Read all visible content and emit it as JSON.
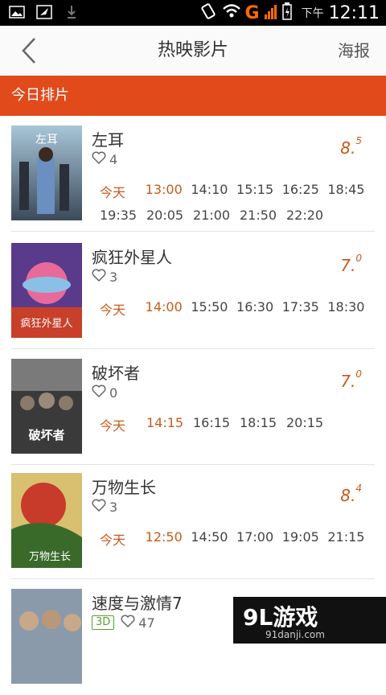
{
  "status_bar": {
    "icons_left": [
      "image-icon",
      "bird-icon",
      "download-icon"
    ],
    "network": "G",
    "ampm": "下午",
    "time": "12:11"
  },
  "header": {
    "title": "热映影片",
    "poster_label": "海报"
  },
  "section": {
    "title": "今日排片"
  },
  "movies": [
    {
      "title": "左耳",
      "likes": "4",
      "rating_main": "8.",
      "rating_sup": "5",
      "badge": "",
      "today_label": "今天",
      "times_row1": [
        "13:00",
        "14:10",
        "15:15",
        "16:25",
        "18:45"
      ],
      "times_row2": [
        "19:35",
        "20:05",
        "21:00",
        "21:50",
        "22:20"
      ],
      "poster_text": "左耳"
    },
    {
      "title": "疯狂外星人",
      "likes": "3",
      "rating_main": "7.",
      "rating_sup": "0",
      "badge": "",
      "today_label": "今天",
      "times_row1": [
        "14:00",
        "15:50",
        "16:30",
        "17:35",
        "18:30"
      ],
      "times_row2": [],
      "poster_text": "疯狂外星人"
    },
    {
      "title": "破坏者",
      "likes": "0",
      "rating_main": "7.",
      "rating_sup": "0",
      "badge": "",
      "today_label": "今天",
      "times_row1": [
        "14:15",
        "16:15",
        "18:15",
        "20:15"
      ],
      "times_row2": [],
      "poster_text": "破坏者"
    },
    {
      "title": "万物生长",
      "likes": "3",
      "rating_main": "8.",
      "rating_sup": "4",
      "badge": "",
      "today_label": "今天",
      "times_row1": [
        "12:50",
        "14:50",
        "17:00",
        "19:05",
        "21:15"
      ],
      "times_row2": [],
      "poster_text": "万物生长"
    },
    {
      "title": "速度与激情7",
      "likes": "47",
      "rating_main": "",
      "rating_sup": "",
      "badge": "3D",
      "today_label": "",
      "times_row1": [],
      "times_row2": [],
      "poster_text": ""
    }
  ],
  "watermark": {
    "main": "9L游戏",
    "sub": "91danji.com"
  },
  "colors": {
    "accent": "#e14a1a",
    "rating": "#c85a1a",
    "badge3d": "#5aa02c"
  }
}
